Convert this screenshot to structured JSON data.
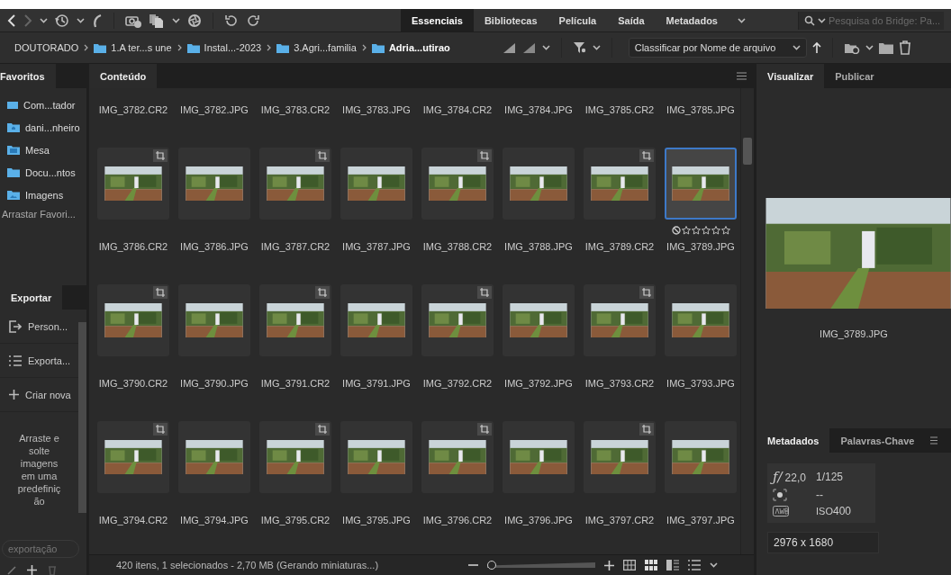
{
  "toolbar": {
    "workspaces": [
      {
        "label": "Essenciais",
        "selected": true
      },
      {
        "label": "Bibliotecas",
        "selected": false
      },
      {
        "label": "Película",
        "selected": false
      },
      {
        "label": "Saída",
        "selected": false
      },
      {
        "label": "Metadados",
        "selected": false
      }
    ],
    "search": {
      "placeholder": "Pesquisa do Bridge: Pa..."
    }
  },
  "path_bar": {
    "crumbs": [
      {
        "label": "DOUTORADO",
        "kind": "root",
        "current": false
      },
      {
        "label": "1.A ter...s une",
        "kind": "folder",
        "current": false
      },
      {
        "label": "Instal...-2023",
        "kind": "folder",
        "current": false
      },
      {
        "label": "3.Agri...familia",
        "kind": "folder",
        "current": false
      },
      {
        "label": "Adria...utirao",
        "kind": "folder",
        "current": true
      }
    ],
    "sort": {
      "value": "Classificar por Nome de arquivo"
    }
  },
  "favorites": {
    "title": "Favoritos",
    "items": [
      {
        "label": "Com...tador",
        "kind": "computer"
      },
      {
        "label": "dani...nheiro",
        "kind": "home"
      },
      {
        "label": "Mesa",
        "kind": "desktop"
      },
      {
        "label": "Docu...ntos",
        "kind": "folder"
      },
      {
        "label": "Imagens",
        "kind": "pictures"
      }
    ],
    "hint": "Arrastar Favori..."
  },
  "export": {
    "title": "Exportar",
    "items": [
      {
        "label": "Person...",
        "kind": "export"
      },
      {
        "label": "Exporta...",
        "kind": "list"
      },
      {
        "label": "Criar nova",
        "kind": "add"
      }
    ],
    "hint": "Arraste e solte imagens em uma predefinição",
    "search": {
      "placeholder": "exportação"
    }
  },
  "content": {
    "tab": "Conteúdo",
    "top_row_names": [
      "IMG_3782.CR2",
      "IMG_3782.JPG",
      "IMG_3783.CR2",
      "IMG_3783.JPG",
      "IMG_3784.CR2",
      "IMG_3784.JPG",
      "IMG_3785.CR2",
      "IMG_3785.JPG"
    ],
    "items": [
      {
        "name": "IMG_3786.CR2",
        "crop": true,
        "selected": false
      },
      {
        "name": "IMG_3786.JPG",
        "crop": false,
        "selected": false
      },
      {
        "name": "IMG_3787.CR2",
        "crop": true,
        "selected": false
      },
      {
        "name": "IMG_3787.JPG",
        "crop": false,
        "selected": false
      },
      {
        "name": "IMG_3788.CR2",
        "crop": true,
        "selected": false
      },
      {
        "name": "IMG_3788.JPG",
        "crop": false,
        "selected": false
      },
      {
        "name": "IMG_3789.CR2",
        "crop": true,
        "selected": false
      },
      {
        "name": "IMG_3789.JPG",
        "crop": false,
        "selected": true,
        "stars": 0
      },
      {
        "name": "IMG_3790.CR2",
        "crop": true,
        "selected": false
      },
      {
        "name": "IMG_3790.JPG",
        "crop": false,
        "selected": false
      },
      {
        "name": "IMG_3791.CR2",
        "crop": true,
        "selected": false
      },
      {
        "name": "IMG_3791.JPG",
        "crop": false,
        "selected": false
      },
      {
        "name": "IMG_3792.CR2",
        "crop": true,
        "selected": false
      },
      {
        "name": "IMG_3792.JPG",
        "crop": false,
        "selected": false
      },
      {
        "name": "IMG_3793.CR2",
        "crop": true,
        "selected": false
      },
      {
        "name": "IMG_3793.JPG",
        "crop": false,
        "selected": false
      },
      {
        "name": "IMG_3794.CR2",
        "crop": true,
        "selected": false
      },
      {
        "name": "IMG_3794.JPG",
        "crop": false,
        "selected": false
      },
      {
        "name": "IMG_3795.CR2",
        "crop": true,
        "selected": false
      },
      {
        "name": "IMG_3795.JPG",
        "crop": false,
        "selected": false
      },
      {
        "name": "IMG_3796.CR2",
        "crop": true,
        "selected": false
      },
      {
        "name": "IMG_3796.JPG",
        "crop": false,
        "selected": false
      },
      {
        "name": "IMG_3797.CR2",
        "crop": true,
        "selected": false
      },
      {
        "name": "IMG_3797.JPG",
        "crop": false,
        "selected": false
      }
    ]
  },
  "preview": {
    "tabs": [
      {
        "label": "Visualizar",
        "selected": true
      },
      {
        "label": "Publicar",
        "selected": false
      }
    ],
    "filename": "IMG_3789.JPG"
  },
  "metadata": {
    "tabs": [
      {
        "label": "Metadados",
        "selected": true
      },
      {
        "label": "Palavras-Chave",
        "selected": false
      }
    ],
    "aperture_symbol": "ƒ/",
    "aperture": "22,0",
    "shutter": "1/125",
    "metering": "--",
    "iso_label": "ISO",
    "iso": "400",
    "dimensions": "2976 x 1680"
  },
  "status_bar": {
    "summary": "420 itens, 1 selecionados - 2,70 MB (Gerando miniaturas...)",
    "thumbnail_size": {
      "level": 0.04
    }
  }
}
